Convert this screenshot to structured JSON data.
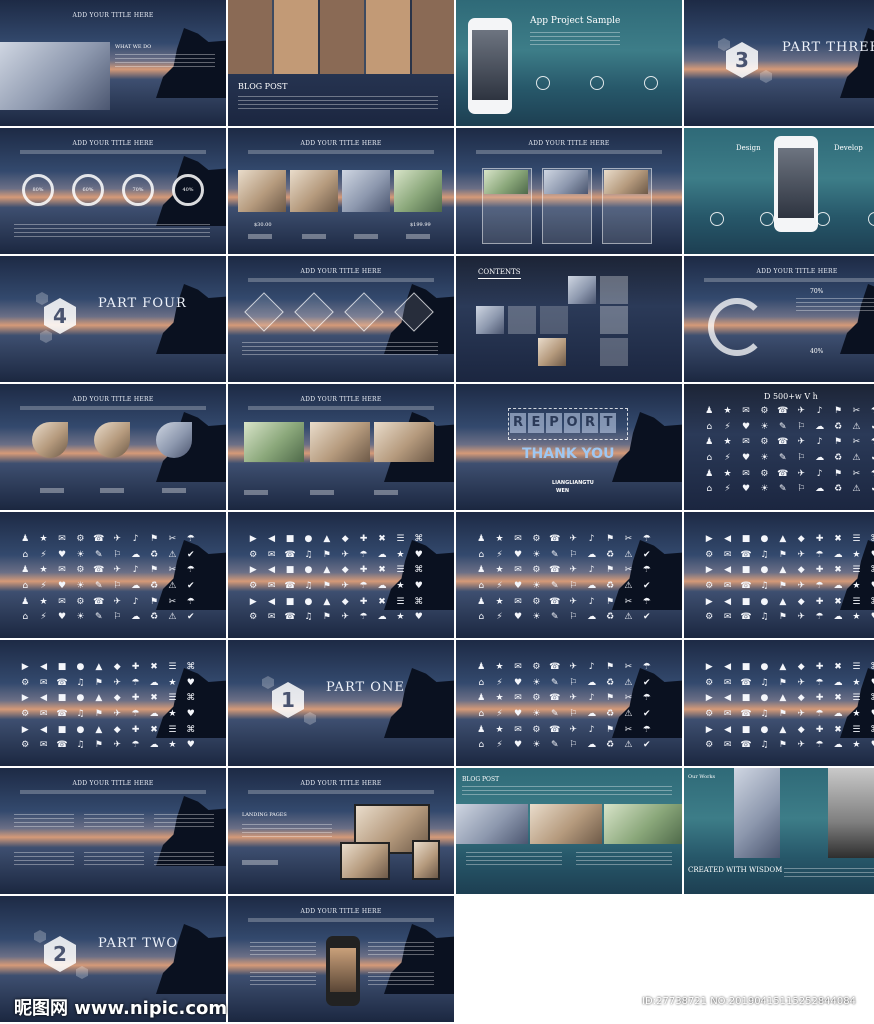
{
  "slides": {
    "title_generic": "ADD YOUR TITLE HERE",
    "blog_post": "BLOG POST",
    "blog_post_caps": "BLOG POST",
    "app_project": "App Project Sample",
    "part_one": "PART ONE",
    "part_two": "PART TWO",
    "part_three": "PART THREE",
    "part_four": "PART FOUR",
    "num_one": "1",
    "num_two": "2",
    "num_three": "3",
    "num_four": "4",
    "contents": "CONTENTS",
    "report_letters": [
      "R",
      "E",
      "P",
      "O",
      "R",
      "T"
    ],
    "thank_you": "THANK YOU",
    "liangliang_line1": "LIANGLIANGTU",
    "liangliang_line2": "WEN",
    "design": "Design",
    "develop": "Develop",
    "what_we_do": "WHAT WE DO",
    "landing_pages": "LANDING PAGES",
    "our_works": "Our Works",
    "created_with_wisdom": "CREATED WITH WISDOM",
    "icons_header": "D 500+w  V h",
    "pct_70": "70%",
    "pct_40": "40%",
    "price_30": "$30.00",
    "price_199": "$199.99",
    "ring_labels": [
      "80%",
      "60%",
      "70%",
      "40%"
    ]
  },
  "watermark": {
    "site": "昵图网 www.nipic.com",
    "id_line": "ID:27738721 NO:20190415115252844084"
  },
  "icons": {
    "set_a": [
      "♟",
      "★",
      "✉",
      "⚙",
      "☎",
      "✈",
      "♪",
      "⚑",
      "✂",
      "☂",
      "⌂",
      "⚡",
      "♥",
      "☀",
      "✎",
      "⚐",
      "☁",
      "♻",
      "⚠",
      "✔"
    ],
    "set_b": [
      "▶",
      "◀",
      "■",
      "●",
      "▲",
      "◆",
      "✚",
      "✖",
      "☰",
      "⌘",
      "⚙",
      "✉",
      "☎",
      "♫",
      "⚑",
      "✈",
      "☂",
      "☁",
      "★",
      "♥"
    ]
  }
}
